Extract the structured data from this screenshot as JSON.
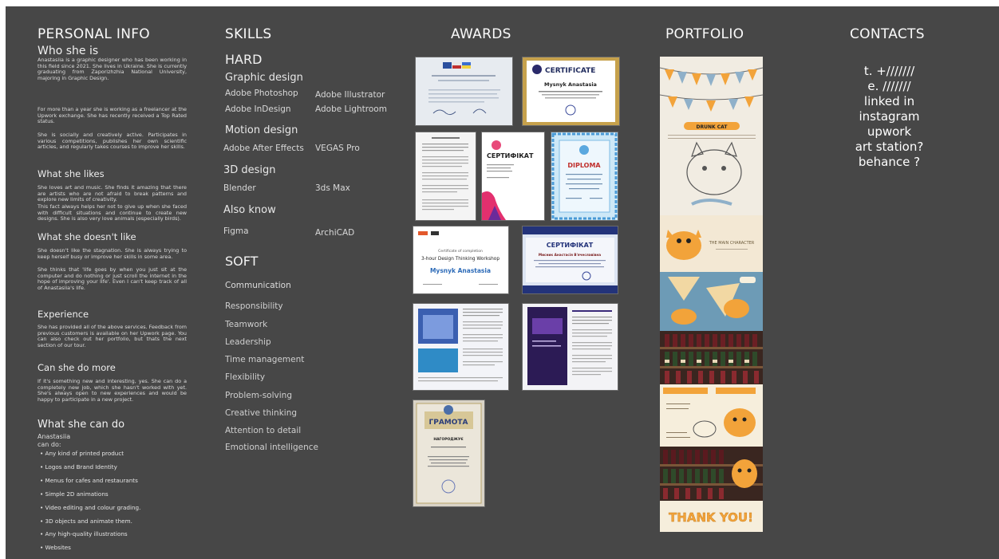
{
  "personal_info": {
    "title": "PERSONAL INFO",
    "who_title": "Who she is",
    "who_p1": "Anastasiia is a graphic designer who has been working in this field since 2021. She lives in Ukraine. She is currently graduating from Zaporizhzhia National University, majoring in Graphic Design.",
    "who_p2": "For more than a year she is working as a freelancer at the Upwork exchange. She has recently received a Top Rated status.",
    "who_p3": "She is socially and creatively active. Participates in various competitions, publishes her own scientific articles, and regularly takes courses to improve her skills.",
    "likes_title": "What she likes",
    "likes_p1": "She loves art and music. She finds it amazing that there are artists who are not afraid to break patterns and explore new limits of creativity.",
    "likes_p2": "This fact always helps her not to give up when she faced with difficult situations and continue to create new designs. She is also very love animals (especially birds).",
    "dislikes_title": "What she doesn't like",
    "dislikes_p1": "She doesn't like the stagnation. She is always trying to keep herself busy or improve her skills in some area.",
    "dislikes_p2": "She thinks that 'life goes by when you just sit at the computer and do nothing or just scroll the internet in the hope of improving your life'. Even I can't keep track of all of Anastasiia's life.",
    "experience_title": "Experience",
    "experience_p": "She has provided all of the above services. Feedback from previous customers is available on her Upwork page. You can also check out her portfolio, but thats the next section of our tour.",
    "more_title": "Can she do more",
    "more_p": "If it's something new and interesting, yes. She can do a completely new job, which she hasn't worked with yet. She's always open to new experiences and would be happy to participate in a new project.",
    "cando_title": "What she can do",
    "cando_sub": "Anastasiia can do:",
    "cando_items": [
      "Any kind of printed product",
      "Logos and Brand Identity",
      "Menus for cafes and restaurants",
      "Simple 2D animations",
      "Video editing and colour grading.",
      "3D objects and animate them.",
      "Any high-quality illustrations",
      "Websites"
    ]
  },
  "skills": {
    "title": "SKILLS",
    "hard_title": "HARD",
    "graphic_title": "Graphic design",
    "graphic_items": [
      "Adobe Photoshop",
      "Adobe Illustrator",
      "Adobe InDesign",
      "Adobe Lightroom"
    ],
    "motion_title": "Motion design",
    "motion_items": [
      "Adobe After Effects",
      "VEGAS Pro"
    ],
    "design3d_title": "3D design",
    "design3d_items": [
      "Blender",
      "3ds Max"
    ],
    "also_title": "Also know",
    "also_items": [
      "Figma",
      "ArchiCAD"
    ],
    "soft_title": "SOFT",
    "soft_items": [
      "Communication",
      "Responsibility",
      "Teamwork",
      "Leadership",
      "Time management",
      "Flexibility",
      "Problem-solving",
      "Creative thinking",
      "Attention to detail",
      "Emotional intelligence"
    ]
  },
  "awards": {
    "title": "AWARDS",
    "certificate_word": "CERTIFICATE",
    "certificate_name": "Mysnyk Anastasia",
    "sertifikat_word": "СЕРТИФІКАТ",
    "diploma_word": "DIPLOMA",
    "workshop_caption": "Certificate of completion",
    "workshop_title": "3-hour Design Thinking Workshop",
    "workshop_name": "Mysnyk Anastasia",
    "conf_word": "СЕРТИФІКАТ",
    "conf_name": "Мисник Анастасія В'ячеславівна",
    "gramota_word": "ГРАМОТА",
    "gramota_sub": "НАГОРОДЖУЄ"
  },
  "portfolio": {
    "title": "PORTFOLIO",
    "drunk_cat": "DRUNK CAT",
    "main_character": "THE MAIN CHARACTER",
    "thank_you": "THANK YOU!"
  },
  "contacts": {
    "title": "CONTACTS",
    "phone": "t. +///////",
    "email": "e. ///////",
    "linkedin": "linked in",
    "instagram": "instagram",
    "upwork": "upwork",
    "artstation": "art station?",
    "behance": "behance ?"
  }
}
